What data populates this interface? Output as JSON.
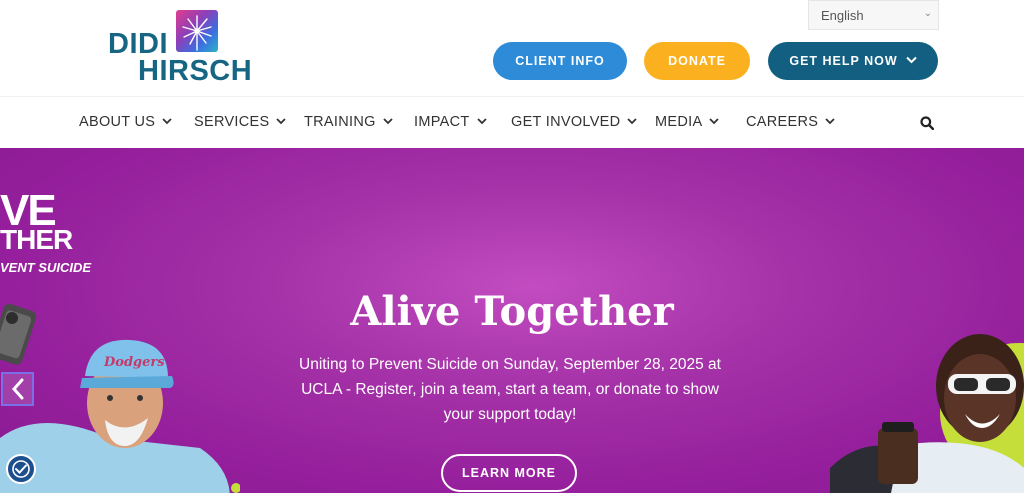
{
  "logo": {
    "line1": "DIDI",
    "line2": "HIRSCH"
  },
  "language": {
    "selected": "English"
  },
  "header_buttons": {
    "client_info": "CLIENT INFO",
    "donate": "DONATE",
    "get_help": "GET HELP NOW"
  },
  "nav": {
    "items": [
      {
        "label": "ABOUT US"
      },
      {
        "label": "SERVICES"
      },
      {
        "label": "TRAINING"
      },
      {
        "label": "IMPACT"
      },
      {
        "label": "GET INVOLVED"
      },
      {
        "label": "MEDIA"
      },
      {
        "label": "CAREERS"
      }
    ]
  },
  "hero": {
    "title": "Alive Together",
    "subtitle": "Uniting to Prevent Suicide on Sunday, September 28, 2025 at UCLA - Register, join a team, start a team, or donate to show your support today!",
    "cta": "LEARN MORE",
    "brand_line1": "VE",
    "brand_line2": "THER",
    "brand_line3": "VENT SUICIDE",
    "cap_text": "Dodgers"
  },
  "colors": {
    "brand_teal": "#156583",
    "client_info": "#2e8bd8",
    "donate": "#fbb11f",
    "get_help": "#125f82",
    "hero_purple": "#a532a8"
  }
}
